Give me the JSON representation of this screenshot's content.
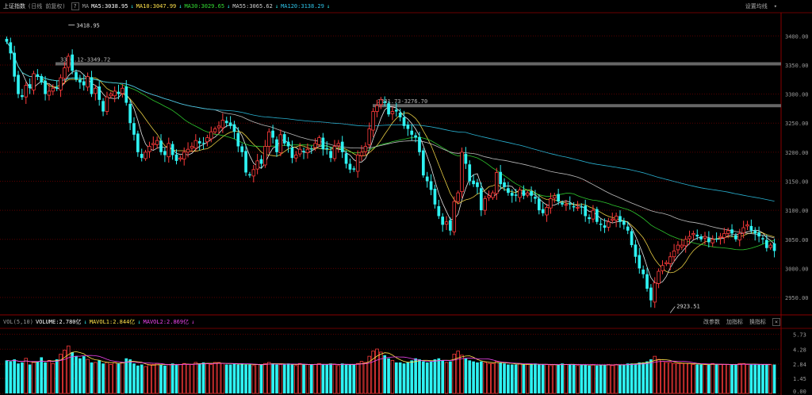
{
  "header": {
    "title": "上证指数",
    "period": "(日线 前复权)",
    "help": "?",
    "ma_label": "MA",
    "ma_values": [
      {
        "text": "MA5:3038.95",
        "arrow": "↓",
        "color": "#ffffff"
      },
      {
        "text": "MA10:3047.99",
        "arrow": "↓",
        "color": "#ffe24a"
      },
      {
        "text": "MA30:3029.65",
        "arrow": "↓",
        "color": "#33dd33"
      },
      {
        "text": "MA55:3065.62",
        "arrow": "↓",
        "color": "#cfcfcf"
      },
      {
        "text": "MA120:3138.29",
        "arrow": "↓",
        "color": "#2ec4e8"
      }
    ],
    "settings": "设置均线"
  },
  "volume_header": {
    "label": "VOL(5,10)",
    "values": [
      {
        "text": "VOLUME:2.780亿",
        "arrow": "↓",
        "color": "#ffffff"
      },
      {
        "text": "MAVOL1:2.844亿",
        "arrow": "↓",
        "color": "#ffe24a"
      },
      {
        "text": "MAVOL2:2.869亿",
        "arrow": "↓",
        "color": "#ee44ee"
      }
    ],
    "buttons": [
      "改参数",
      "加指标",
      "换指标"
    ],
    "close": "×"
  },
  "colors": {
    "up": "#ff3b3b",
    "down": "#2ef2f2",
    "grid": "#5a0000",
    "hline": "#666666"
  },
  "chart_data": [
    {
      "type": "candlestick",
      "price_axis": {
        "ylim": [
          2920,
          3440
        ],
        "ticks": [
          3400,
          3350,
          3300,
          3250,
          3200,
          3150,
          3100,
          3050,
          3000,
          2950
        ],
        "tick_labels": [
          "3400.00",
          "3350.00",
          "3300.00",
          "3250.00",
          "3200.00",
          "3150.00",
          "3100.00",
          "3050.00",
          "3000.00",
          "2950.00"
        ]
      },
      "annotations": {
        "high": "3418.95",
        "low": "2923.51",
        "hline1": "3356.12-3349.72",
        "hline2": "3281.73-3276.70"
      },
      "hlines": [
        3352,
        3280
      ],
      "high_index": 16,
      "low_index": 172,
      "close": [
        3390,
        3370,
        3330,
        3300,
        3295,
        3315,
        3310,
        3335,
        3330,
        3320,
        3300,
        3305,
        3310,
        3310,
        3328,
        3345,
        3365,
        3340,
        3325,
        3320,
        3315,
        3330,
        3300,
        3310,
        3290,
        3270,
        3295,
        3300,
        3305,
        3300,
        3310,
        3285,
        3250,
        3230,
        3200,
        3190,
        3200,
        3210,
        3215,
        3220,
        3200,
        3195,
        3215,
        3195,
        3185,
        3190,
        3200,
        3205,
        3210,
        3220,
        3215,
        3215,
        3225,
        3235,
        3240,
        3245,
        3255,
        3250,
        3245,
        3235,
        3210,
        3200,
        3165,
        3160,
        3170,
        3185,
        3180,
        3210,
        3235,
        3225,
        3200,
        3230,
        3215,
        3210,
        3190,
        3195,
        3205,
        3200,
        3205,
        3205,
        3215,
        3225,
        3205,
        3205,
        3190,
        3210,
        3215,
        3200,
        3180,
        3170,
        3170,
        3195,
        3200,
        3210,
        3240,
        3270,
        3280,
        3290,
        3285,
        3265,
        3270,
        3270,
        3260,
        3245,
        3240,
        3230,
        3225,
        3200,
        3160,
        3150,
        3135,
        3110,
        3090,
        3075,
        3080,
        3065,
        3115,
        3130,
        3200,
        3180,
        3150,
        3145,
        3140,
        3100,
        3120,
        3125,
        3130,
        3165,
        3145,
        3140,
        3130,
        3125,
        3125,
        3135,
        3125,
        3130,
        3125,
        3120,
        3100,
        3095,
        3105,
        3120,
        3125,
        3115,
        3110,
        3110,
        3110,
        3105,
        3105,
        3105,
        3090,
        3085,
        3100,
        3080,
        3075,
        3070,
        3080,
        3085,
        3090,
        3080,
        3075,
        3065,
        3040,
        3020,
        3000,
        2990,
        2965,
        2945,
        2975,
        2995,
        3005,
        3010,
        3020,
        3030,
        3040,
        3040,
        3050,
        3055,
        3060,
        3055,
        3050,
        3055,
        3045,
        3050,
        3050,
        3055,
        3060,
        3065,
        3060,
        3050,
        3060,
        3070,
        3075,
        3065,
        3060,
        3055,
        3050,
        3035,
        3040,
        3030
      ],
      "overlays": [
        "MA5",
        "MA10",
        "MA30",
        "MA55",
        "MA120"
      ]
    },
    {
      "type": "bar",
      "volume_axis": {
        "ylim": [
          0,
          6.3
        ],
        "ticks": [
          5.73,
          4.28,
          2.84,
          1.45,
          0
        ],
        "tick_labels": [
          "5.73",
          "4.28",
          "2.84",
          "1.45",
          "0.00"
        ]
      },
      "volume": [
        3.2,
        3.1,
        3.3,
        2.9,
        3.0,
        3.4,
        2.8,
        3.0,
        3.1,
        3.5,
        3.0,
        3.2,
        2.9,
        3.3,
        3.8,
        4.2,
        4.6,
        4.0,
        3.6,
        3.4,
        3.6,
        3.3,
        3.0,
        3.0,
        3.2,
        2.9,
        3.0,
        2.8,
        3.0,
        2.9,
        3.0,
        3.4,
        3.3,
        2.9,
        2.7,
        2.8,
        2.6,
        2.8,
        2.8,
        2.9,
        2.8,
        2.7,
        2.8,
        2.9,
        2.8,
        2.8,
        2.9,
        2.8,
        2.8,
        3.0,
        2.9,
        3.0,
        2.9,
        2.8,
        3.0,
        3.0,
        2.9,
        2.8,
        2.8,
        2.9,
        2.8,
        2.9,
        2.8,
        2.8,
        2.7,
        2.8,
        2.8,
        2.9,
        3.0,
        2.9,
        2.8,
        2.8,
        2.8,
        2.9,
        2.8,
        2.7,
        2.9,
        2.8,
        2.8,
        2.8,
        2.8,
        2.9,
        2.8,
        2.8,
        2.9,
        2.8,
        2.7,
        2.9,
        2.8,
        2.8,
        2.8,
        2.9,
        3.1,
        3.0,
        3.6,
        4.1,
        4.3,
        4.0,
        3.7,
        3.4,
        3.2,
        3.0,
        3.0,
        2.9,
        3.0,
        3.2,
        3.4,
        3.3,
        3.1,
        3.0,
        3.1,
        3.3,
        3.4,
        3.2,
        3.0,
        3.1,
        3.8,
        4.1,
        3.7,
        3.4,
        3.2,
        3.1,
        3.0,
        3.1,
        3.0,
        2.9,
        2.9,
        3.1,
        3.0,
        2.9,
        2.8,
        2.8,
        2.8,
        2.9,
        2.8,
        2.8,
        2.8,
        2.9,
        2.8,
        2.8,
        2.8,
        2.7,
        2.8,
        2.8,
        2.9,
        2.8,
        2.8,
        2.8,
        2.7,
        2.8,
        2.8,
        2.7,
        2.8,
        2.7,
        2.8,
        2.8,
        2.8,
        2.7,
        2.8,
        2.8,
        2.8,
        2.9,
        2.9,
        2.9,
        3.0,
        3.0,
        3.1,
        3.3,
        3.6,
        3.3,
        3.1,
        3.0,
        3.0,
        2.9,
        2.9,
        2.9,
        2.9,
        2.9,
        2.8,
        2.8,
        2.8,
        2.8,
        2.8,
        2.9,
        2.8,
        2.8,
        2.8,
        2.8,
        2.8,
        2.8,
        2.9,
        2.9,
        2.8,
        2.8,
        2.8,
        2.8,
        2.8,
        2.8,
        2.78
      ],
      "overlays": [
        "MAVOL1",
        "MAVOL2"
      ]
    }
  ]
}
